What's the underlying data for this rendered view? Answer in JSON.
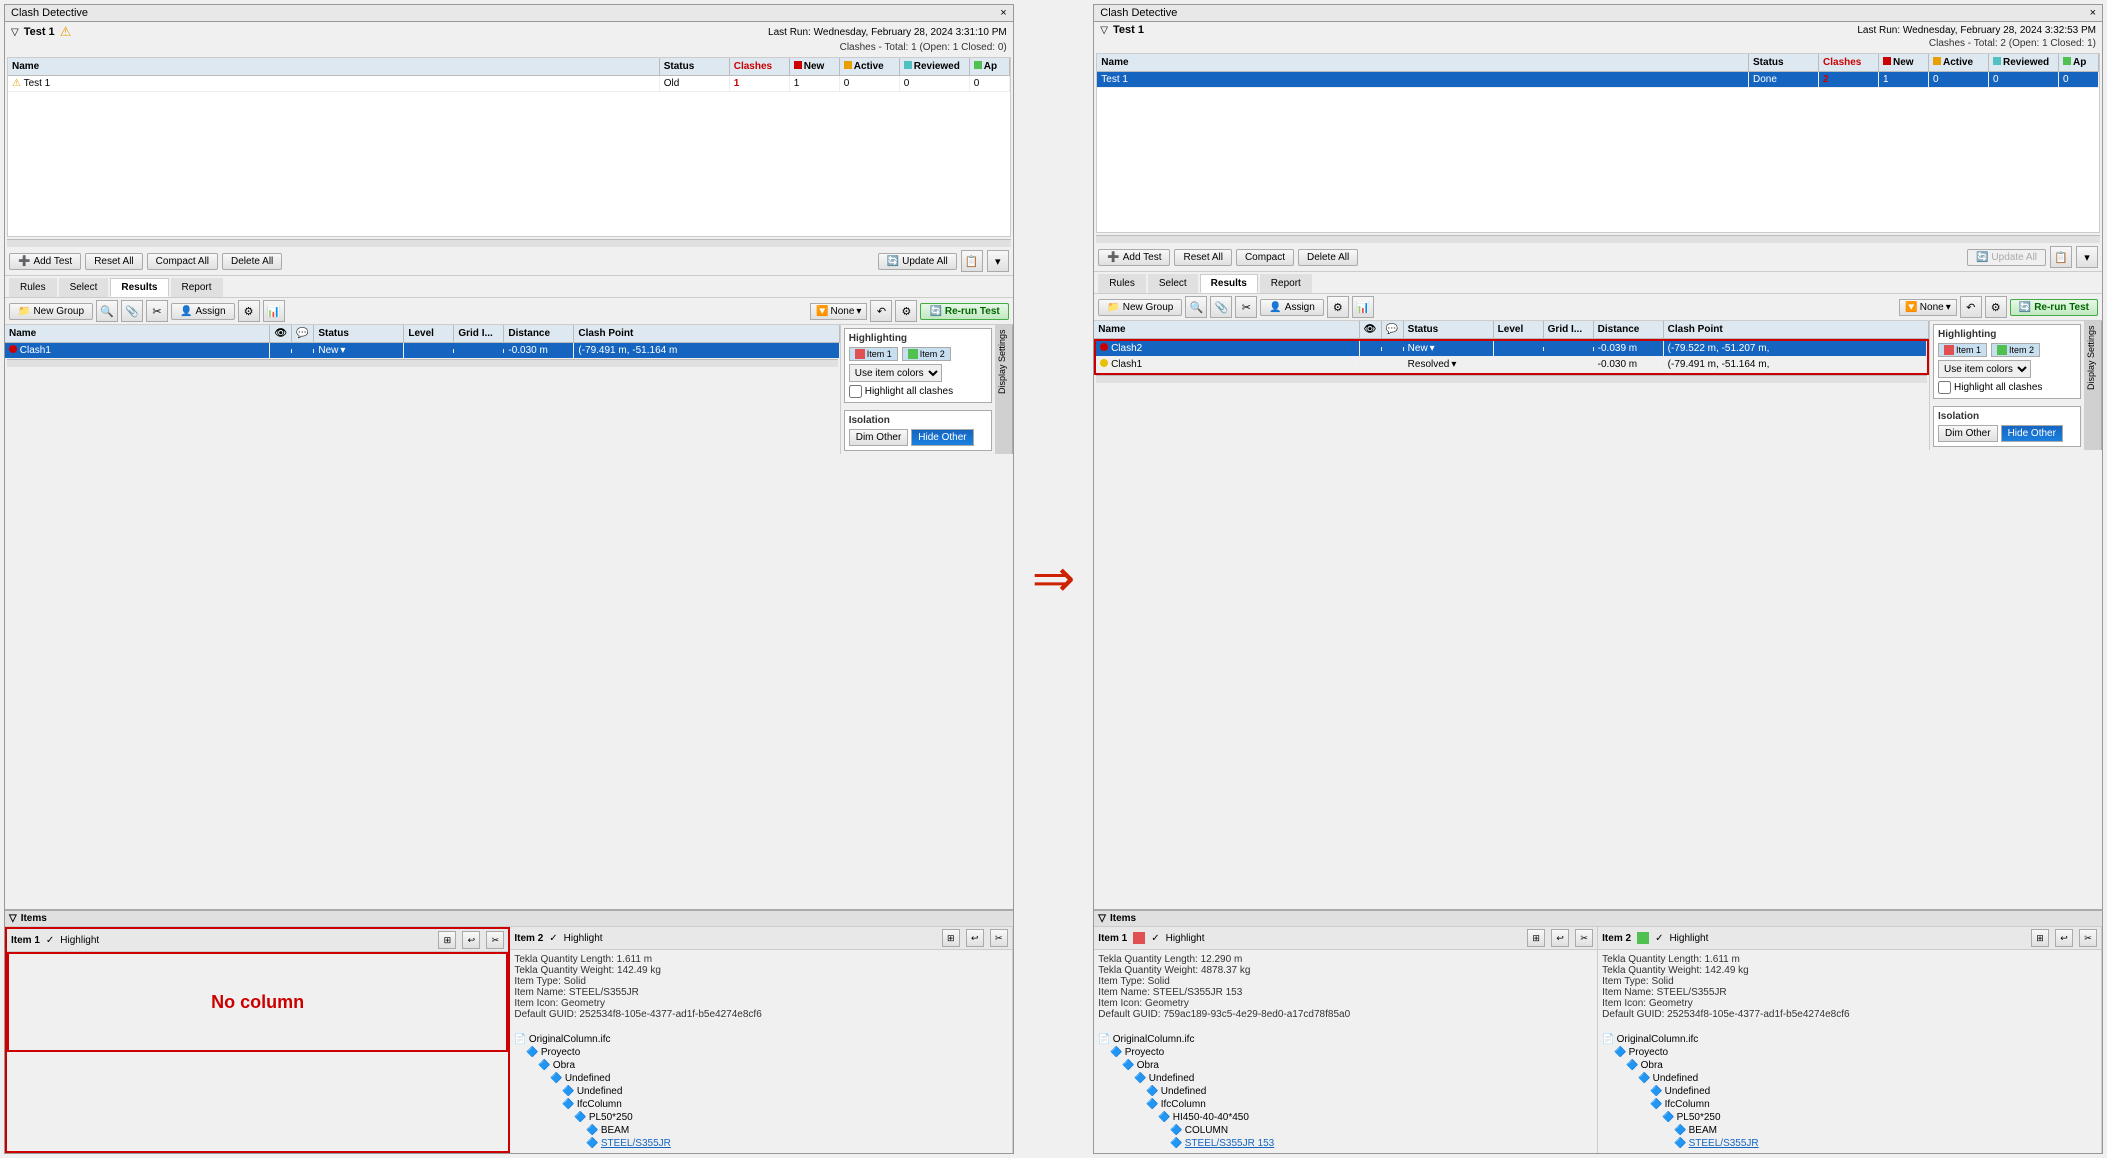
{
  "panels": [
    {
      "id": "left",
      "title": "Clash Detective",
      "close_btn": "×",
      "test_name": "Test 1",
      "has_warning": true,
      "last_run_label": "Last Run:",
      "last_run_value": "Wednesday, February 28, 2024 3:31:10 PM",
      "clashes_summary": "Clashes - Total: 1 (Open: 1 Closed: 0)",
      "table_headers": [
        "Name",
        "Status",
        "Clashes",
        "New",
        "Active",
        "Reviewed",
        "Ap"
      ],
      "table_rows": [
        {
          "icon": "warning",
          "name": "Test 1",
          "status": "Old",
          "clashes": "1",
          "new": "1",
          "active": "0",
          "reviewed": "0",
          "ap": "0"
        }
      ],
      "toolbar_buttons": [
        "Add Test",
        "Reset All",
        "Compact All",
        "Delete All",
        "Update All"
      ],
      "tabs": [
        "Rules",
        "Select",
        "Results",
        "Report"
      ],
      "active_tab": "Results",
      "results_toolbar": {
        "new_group": "New Group",
        "assign": "Assign",
        "none_dropdown": "None",
        "rerun": "Re-run Test"
      },
      "results_headers": [
        "Name",
        "",
        "",
        "Status",
        "Level",
        "Grid I...",
        "Distance",
        "Clash Point"
      ],
      "results_rows": [
        {
          "dot_color": "red",
          "name": "Clash1",
          "status": "New",
          "has_dropdown": true,
          "distance": "-0.030 m",
          "clash_point": "(-79.491 m, -51.164 m"
        }
      ],
      "highlighting": {
        "title": "Highlighting",
        "item1": "Item 1",
        "item2": "Item 2",
        "item1_color": "red",
        "item2_color": "green",
        "use_item_colors": "Use item colors",
        "highlight_all": "Highlight all clashes"
      },
      "isolation": {
        "title": "Isolation",
        "dim_other": "Dim Other",
        "hide_other": "Hide Other"
      },
      "items": {
        "title": "Items",
        "item1": {
          "label": "Item 1",
          "highlight_label": "Highlight",
          "has_content": false,
          "no_column_text": "No column"
        },
        "item2": {
          "label": "Item 2",
          "highlight_label": "Highlight",
          "properties": [
            "Tekla Quantity Length: 1.611 m",
            "Tekla Quantity Weight: 142.49 kg",
            "Item Type: Solid",
            "Item Name: STEEL/S355JR",
            "Item Icon: Geometry",
            "Default GUID: 252534f8-105e-4377-ad1f-b5e4274e8cf6"
          ],
          "tree": {
            "root": "OriginalColumn.ifc",
            "children": [
              {
                "label": "Proyecto",
                "indent": 1,
                "icon": "folder"
              },
              {
                "label": "Obra",
                "indent": 2,
                "icon": "mesh"
              },
              {
                "label": "Undefined",
                "indent": 3,
                "icon": "mesh"
              },
              {
                "label": "Undefined",
                "indent": 4,
                "icon": "folder"
              },
              {
                "label": "IfcColumn",
                "indent": 4,
                "icon": "folder"
              },
              {
                "label": "PL50*250",
                "indent": 5,
                "icon": "mesh"
              },
              {
                "label": "BEAM",
                "indent": 6,
                "icon": "folder"
              },
              {
                "label": "STEEL/S355JR",
                "indent": 6,
                "icon": "link",
                "is_link": true
              }
            ]
          }
        }
      }
    },
    {
      "id": "right",
      "title": "Clash Detective",
      "close_btn": "×",
      "test_name": "Test 1",
      "has_warning": false,
      "last_run_label": "Last Run:",
      "last_run_value": "Wednesday, February 28, 2024 3:32:53 PM",
      "clashes_summary": "Clashes - Total: 2 (Open: 1 Closed: 1)",
      "table_headers": [
        "Name",
        "Status",
        "Clashes",
        "New",
        "Active",
        "Reviewed",
        "Ap"
      ],
      "table_rows": [
        {
          "icon": null,
          "name": "Test 1",
          "status": "Done",
          "clashes": "2",
          "new": "1",
          "active": "0",
          "reviewed": "0",
          "ap": "0",
          "selected": true
        }
      ],
      "toolbar_buttons": [
        "Add Test",
        "Reset All",
        "Compact",
        "Delete All",
        "Update All"
      ],
      "tabs": [
        "Rules",
        "Select",
        "Results",
        "Report"
      ],
      "active_tab": "Results",
      "results_toolbar": {
        "new_group": "New Group",
        "assign": "Assign",
        "none_dropdown": "None",
        "rerun": "Re-run Test"
      },
      "results_headers": [
        "Name",
        "",
        "",
        "Status",
        "Level",
        "Grid I...",
        "Distance",
        "Clash Point"
      ],
      "results_rows": [
        {
          "dot_color": "red",
          "name": "Clash2",
          "status": "New",
          "has_dropdown": true,
          "distance": "-0.039 m",
          "clash_point": "(-79.522 m, -51.207 m,",
          "selected": true
        },
        {
          "dot_color": "yellow",
          "name": "Clash1",
          "status": "Resolved",
          "has_dropdown": true,
          "distance": "-0.030 m",
          "clash_point": "(-79.491 m, -51.164 m,"
        }
      ],
      "highlighting": {
        "title": "Highlighting",
        "item1": "Item 1",
        "item2": "Item 2",
        "item1_color": "red",
        "item2_color": "green",
        "use_item_colors": "Use item colors",
        "highlight_all": "Highlight all clashes"
      },
      "isolation": {
        "title": "Isolation",
        "dim_other": "Dim Other",
        "hide_other": "Hide Other"
      },
      "items": {
        "title": "Items",
        "item1": {
          "label": "Item 1",
          "highlight_label": "Highlight",
          "has_content": true,
          "color": "red",
          "properties": [
            "Tekla Quantity Length: 12.290 m",
            "Tekla Quantity Weight: 4878.37 kg",
            "Item Type: Solid",
            "Item Name: STEEL/S355JR 153",
            "Item Icon: Geometry",
            "Default GUID: 759ac189-93c5-4e29-8ed0-a17cd78f85a0"
          ],
          "tree": {
            "root": "OriginalColumn.ifc",
            "children": [
              {
                "label": "Proyecto",
                "indent": 1,
                "icon": "folder"
              },
              {
                "label": "Obra",
                "indent": 2,
                "icon": "mesh"
              },
              {
                "label": "Undefined",
                "indent": 3,
                "icon": "mesh"
              },
              {
                "label": "Undefined",
                "indent": 4,
                "icon": "folder"
              },
              {
                "label": "IfcColumn",
                "indent": 4,
                "icon": "folder"
              },
              {
                "label": "HI450-40-40*450",
                "indent": 5,
                "icon": "mesh"
              },
              {
                "label": "COLUMN",
                "indent": 6,
                "icon": "folder"
              },
              {
                "label": "STEEL/S355JR 153",
                "indent": 6,
                "icon": "link",
                "is_link": true
              }
            ]
          }
        },
        "item2": {
          "label": "Item 2",
          "highlight_label": "Highlight",
          "color": "green",
          "properties": [
            "Tekla Quantity Length: 1.611 m",
            "Tekla Quantity Weight: 142.49 kg",
            "Item Type: Solid",
            "Item Name: STEEL/S355JR",
            "Item Icon: Geometry",
            "Default GUID: 252534f8-105e-4377-ad1f-b5e4274e8cf6"
          ],
          "tree": {
            "root": "OriginalColumn.ifc",
            "children": [
              {
                "label": "Proyecto",
                "indent": 1,
                "icon": "folder"
              },
              {
                "label": "Obra",
                "indent": 2,
                "icon": "mesh"
              },
              {
                "label": "Undefined",
                "indent": 3,
                "icon": "mesh"
              },
              {
                "label": "Undefined",
                "indent": 4,
                "icon": "folder"
              },
              {
                "label": "IfcColumn",
                "indent": 4,
                "icon": "folder"
              },
              {
                "label": "PL50*250",
                "indent": 5,
                "icon": "mesh"
              },
              {
                "label": "BEAM",
                "indent": 6,
                "icon": "folder"
              },
              {
                "label": "STEEL/S355JR",
                "indent": 6,
                "icon": "link",
                "is_link": true
              }
            ]
          }
        }
      }
    }
  ],
  "arrow": "→",
  "display_settings_label": "Display Settings"
}
